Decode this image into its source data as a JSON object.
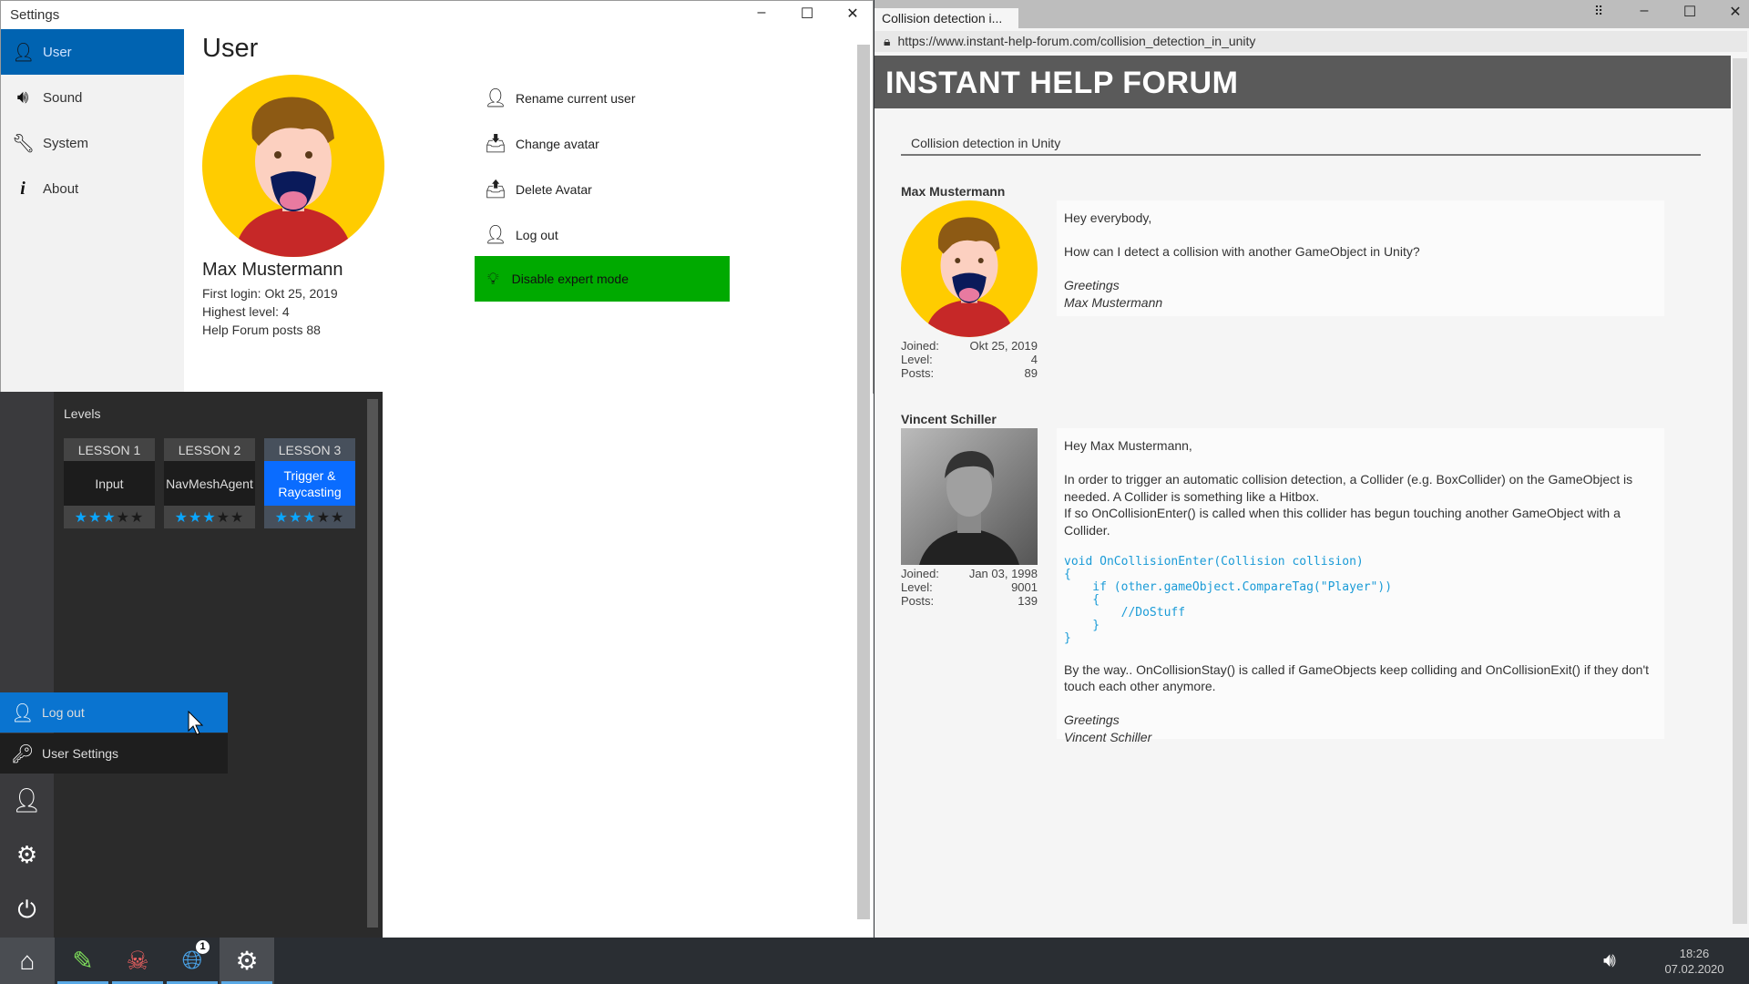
{
  "settings": {
    "title": "Settings",
    "nav": [
      {
        "label": "User",
        "icon": "user-icon"
      },
      {
        "label": "Sound",
        "icon": "speaker-icon"
      },
      {
        "label": "System",
        "icon": "wrench-icon"
      },
      {
        "label": "About",
        "icon": "info-icon"
      }
    ],
    "heading": "User",
    "user": {
      "name": "Max Mustermann",
      "first_login": "First login: Okt 25, 2019",
      "highest_level": "Highest level: 4",
      "posts": "Help Forum posts 88"
    },
    "actions": [
      {
        "label": "Rename current user",
        "icon": "user-icon"
      },
      {
        "label": "Change avatar",
        "icon": "avatar-upload-icon"
      },
      {
        "label": "Delete Avatar",
        "icon": "avatar-delete-icon"
      },
      {
        "label": "Log out",
        "icon": "logout-icon"
      }
    ],
    "expert_button": "Disable expert mode",
    "expert_color": "#00aa00"
  },
  "levels": {
    "title": "Levels",
    "lessons": [
      {
        "header": "LESSON 1",
        "name": "Input",
        "stars": 3,
        "max": 5
      },
      {
        "header": "LESSON 2",
        "name": "NavMeshAgent",
        "stars": 3,
        "max": 5
      },
      {
        "header": "LESSON 3",
        "name": "Trigger & Raycasting",
        "stars": 3,
        "max": 5,
        "active": true
      }
    ]
  },
  "user_menu": {
    "items": [
      {
        "label": "Log out",
        "icon": "logout-icon"
      },
      {
        "label": "User Settings",
        "icon": "key-icon"
      }
    ]
  },
  "taskbar": {
    "apps": [
      "home-icon",
      "edit-icon",
      "skull-icon",
      "globe-icon",
      "gear-icon"
    ],
    "globe_badge": "1",
    "time": "18:26",
    "date": "07.02.2020"
  },
  "browser": {
    "tab": "Collision detection i...",
    "url": "https://www.instant-help-forum.com/collision_detection_in_unity",
    "site_title": "INSTANT HELP FORUM",
    "thread_title": "Collision detection in Unity",
    "posts": [
      {
        "author": "Max Mustermann",
        "joined": "Okt 25, 2019",
        "level": "4",
        "posts": "89",
        "body": [
          "Hey everybody,",
          "How can I detect a collision with another GameObject in Unity?"
        ],
        "sign": [
          "Greetings",
          "Max Mustermann"
        ]
      },
      {
        "author": "Vincent Schiller",
        "joined": "Jan 03, 1998",
        "level": "9001",
        "posts": "139",
        "body": [
          "Hey Max Mustermann,",
          "In order to trigger an automatic collision detection, a Collider (e.g. BoxCollider) on the GameObject is needed. A Collider is something like a Hitbox.\nIf so OnCollisionEnter() is called when this collider has begun touching another GameObject with a Collider."
        ],
        "code": "void OnCollisionEnter(Collision collision)\n{\n    if (other.gameObject.CompareTag(\"Player\"))\n    {\n        //DoStuff\n    }\n}",
        "after": "By the way.. OnCollisionStay() is called if GameObjects keep colliding and OnCollisionExit() if they don't touch each other anymore.",
        "sign": [
          "Greetings",
          "Vincent Schiller"
        ]
      }
    ],
    "labels": {
      "joined": "Joined:",
      "level": "Level:",
      "posts": "Posts:"
    }
  }
}
